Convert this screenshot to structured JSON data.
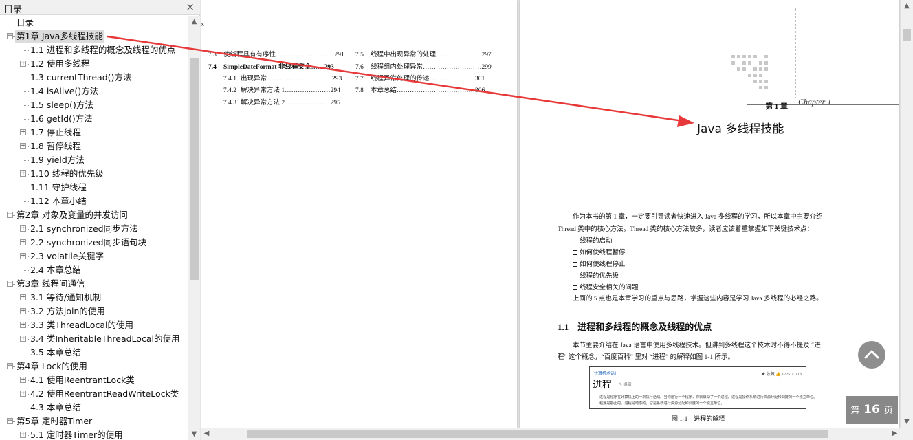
{
  "toc_panel": {
    "title": "目录",
    "close_glyph": "×",
    "items": [
      {
        "label": "目录",
        "level": 0,
        "expandable": false
      },
      {
        "label": "第1章 Java多线程技能",
        "level": 0,
        "expandable": true,
        "selected": true
      },
      {
        "label": "1.1 进程和多线程的概念及线程的优点",
        "level": 1,
        "expandable": false
      },
      {
        "label": "1.2 使用多线程",
        "level": 1,
        "expandable": true
      },
      {
        "label": "1.3 currentThread()方法",
        "level": 1,
        "expandable": false
      },
      {
        "label": "1.4 isAlive()方法",
        "level": 1,
        "expandable": false
      },
      {
        "label": "1.5 sleep()方法",
        "level": 1,
        "expandable": false
      },
      {
        "label": "1.6 getId()方法",
        "level": 1,
        "expandable": false
      },
      {
        "label": "1.7 停止线程",
        "level": 1,
        "expandable": true
      },
      {
        "label": "1.8 暂停线程",
        "level": 1,
        "expandable": true
      },
      {
        "label": "1.9 yield方法",
        "level": 1,
        "expandable": false
      },
      {
        "label": "1.10 线程的优先级",
        "level": 1,
        "expandable": true
      },
      {
        "label": "1.11 守护线程",
        "level": 1,
        "expandable": false
      },
      {
        "label": "1.12 本章小结",
        "level": 1,
        "expandable": false
      },
      {
        "label": "第2章 对象及变量的并发访问",
        "level": 0,
        "expandable": true
      },
      {
        "label": "2.1 synchronized同步方法",
        "level": 1,
        "expandable": true
      },
      {
        "label": "2.2 synchronized同步语句块",
        "level": 1,
        "expandable": true
      },
      {
        "label": "2.3 volatile关键字",
        "level": 1,
        "expandable": true
      },
      {
        "label": "2.4 本章总结",
        "level": 1,
        "expandable": false
      },
      {
        "label": "第3章 线程间通信",
        "level": 0,
        "expandable": true
      },
      {
        "label": "3.1 等待/通知机制",
        "level": 1,
        "expandable": true
      },
      {
        "label": "3.2 方法join的使用",
        "level": 1,
        "expandable": true
      },
      {
        "label": "3.3 类ThreadLocal的使用",
        "level": 1,
        "expandable": true
      },
      {
        "label": "3.4 类InheritableThreadLocal的使用",
        "level": 1,
        "expandable": true
      },
      {
        "label": "3.5 本章总结",
        "level": 1,
        "expandable": false
      },
      {
        "label": "第4章 Lock的使用",
        "level": 0,
        "expandable": true
      },
      {
        "label": "4.1 使用ReentrantLock类",
        "level": 1,
        "expandable": true
      },
      {
        "label": "4.2 使用ReentrantReadWriteLock类",
        "level": 1,
        "expandable": true
      },
      {
        "label": "4.3 本章总结",
        "level": 1,
        "expandable": false
      },
      {
        "label": "第5章 定时器Timer",
        "level": 0,
        "expandable": true
      },
      {
        "label": "5.1 定时器Timer的使用",
        "level": 1,
        "expandable": true
      }
    ]
  },
  "left_page": {
    "edge_char": "x",
    "entries_col1": [
      {
        "num": "7.3",
        "text": "使线程具有有序性",
        "dots": "………………………",
        "page": "291",
        "sub": false,
        "bold": false
      },
      {
        "num": "7.4",
        "text": "SimpleDateFormat 非线程安全",
        "dots": "……",
        "page": "293",
        "sub": false,
        "bold": true
      },
      {
        "num": "7.4.1",
        "text": "出现异常",
        "dots": "…………………………",
        "page": "293",
        "sub": true,
        "bold": false
      },
      {
        "num": "7.4.2",
        "text": "解决异常方法 1",
        "dots": "…………………",
        "page": "294",
        "sub": true,
        "bold": false
      },
      {
        "num": "7.4.3",
        "text": "解决异常方法 2",
        "dots": "…………………",
        "page": "295",
        "sub": true,
        "bold": false
      }
    ],
    "entries_col2": [
      {
        "num": "7.5",
        "text": "线程中出现异常的处理",
        "dots": "…………………",
        "page": "297"
      },
      {
        "num": "7.6",
        "text": "线程组内处理异常",
        "dots": "………………………",
        "page": "299"
      },
      {
        "num": "7.7",
        "text": "线程异常处理的传递",
        "dots": "…………………",
        "page": "301"
      },
      {
        "num": "7.8",
        "text": "本章总结",
        "dots": "………………………………",
        "page": "306"
      }
    ]
  },
  "right_page": {
    "chapter_number": "第 1 章",
    "chapter_script": "Chapter 1",
    "chapter_title": "Java 多线程技能",
    "intro_line1": "作为本书的第 1 章，一定要引导读者快速进入 Java 多线程的学习，所以本章中主要介绍",
    "intro_line2": "Thread 类中的核心方法。Thread 类的核心方法较多，读者应该着重掌握如下关键技术点：",
    "bullets": [
      "线程的启动",
      "如何使线程暂停",
      "如何使线程停止",
      "线程的优先级",
      "线程安全相关的问题"
    ],
    "summary_line": "上面的 5 点也是本章学习的重点与思路，掌握这些内容是学习 Java 多线程的必经之路。",
    "section_title": "1.1　进程和多线程的概念及线程的优点",
    "section_line1": "本节主要介绍在 Java 语言中使用多线程技术。但讲到多线程这个技术时不得不提及 “进",
    "section_line2": "程” 这个概念，“百度百科” 里对 “进程” 的解释如图 1-1 所示。",
    "figure": {
      "tag": "[计算机术语]",
      "term": "进程",
      "edit": "✎ 编辑",
      "stats": "★ 收藏   👍 1225   ⇪ 118",
      "desc1": "进程是程序在计算机上的一次执行活动。当你运行一个程序，你就启动了一个进程。进程是操作系统进行资源分配和调度的一个独立单位。",
      "desc2": "程序是静止的，进程是动态的。它是系统进行资源分配和调度的一个独立单位。",
      "caption": "图 1-1　进程的解释"
    }
  },
  "page_indicator": {
    "prefix": "第",
    "number": "16",
    "suffix": "页"
  },
  "colors": {
    "arrow": "#e8393a",
    "selected_bg": "#dcdcdc",
    "float_bg": "#6e6e6e"
  }
}
